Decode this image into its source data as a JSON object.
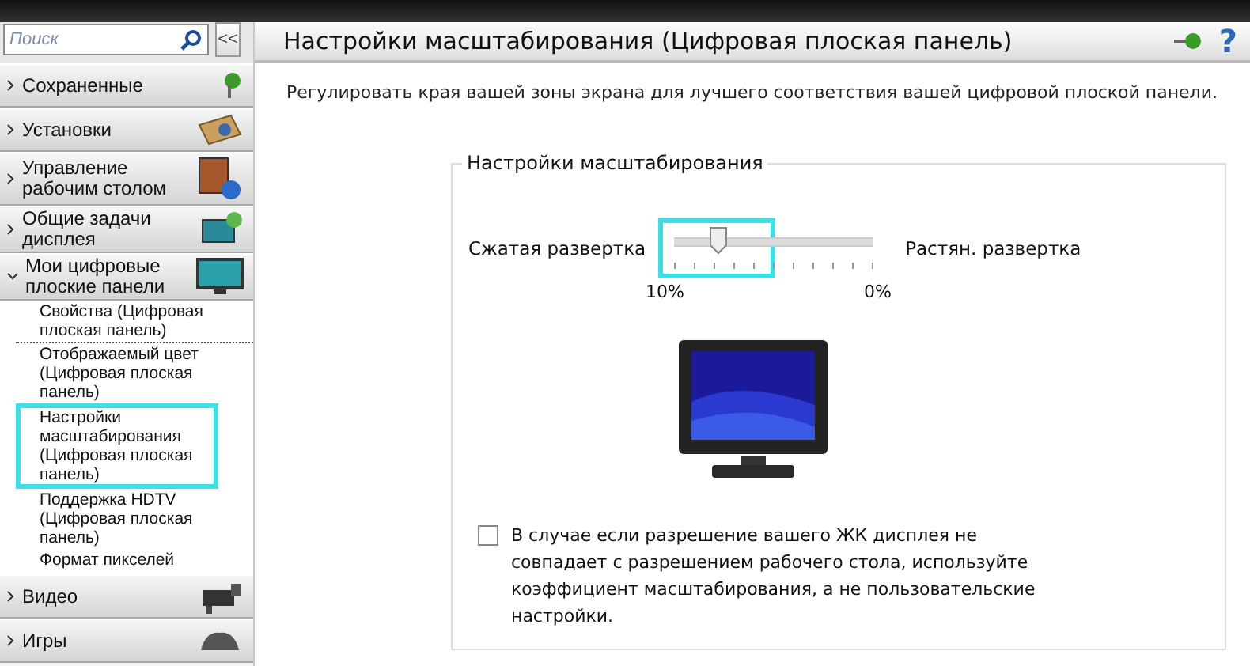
{
  "search": {
    "placeholder": "Поиск",
    "collapse_label": "<<"
  },
  "sidebar": {
    "categories": [
      {
        "label": "Сохраненные",
        "expanded": false
      },
      {
        "label": "Установки",
        "expanded": false
      },
      {
        "label": "Управление рабочим столом",
        "expanded": false
      },
      {
        "label": "Общие задачи дисплея",
        "expanded": false
      },
      {
        "label": "Мои цифровые плоские панели",
        "expanded": true,
        "children": [
          {
            "label": "Свойства (Цифровая плоская панель)",
            "selected": false
          },
          {
            "label": "Отображаемый цвет (Цифровая плоская панель)",
            "selected": false
          },
          {
            "label": "Настройки масштабирования (Цифровая плоская панель)",
            "selected": true
          },
          {
            "label": "Поддержка HDTV (Цифровая плоская панель)",
            "selected": false
          },
          {
            "label": "Формат пикселей",
            "selected": false
          }
        ]
      },
      {
        "label": "Видео",
        "expanded": false
      },
      {
        "label": "Игры",
        "expanded": false
      }
    ]
  },
  "page": {
    "title": "Настройки масштабирования (Цифровая плоская панель)",
    "help_label": "?",
    "description": "Регулировать края вашей зоны экрана для лучшего соответствия вашей цифровой плоской панели.",
    "group": {
      "legend": "Настройки масштабирования",
      "slider": {
        "left_label": "Сжатая развертка",
        "right_label": "Растян. развертка",
        "level": 0.22,
        "highlighted": true,
        "value_label": "10%",
        "end_label": "0%"
      },
      "checkbox": {
        "label": "В случае если разрешение вашего ЖК дисплея не совпадает с разрешением рабочего стола, используйте коэффициент масштабирования, а не пользовательские настройки.",
        "checked": false
      }
    }
  }
}
